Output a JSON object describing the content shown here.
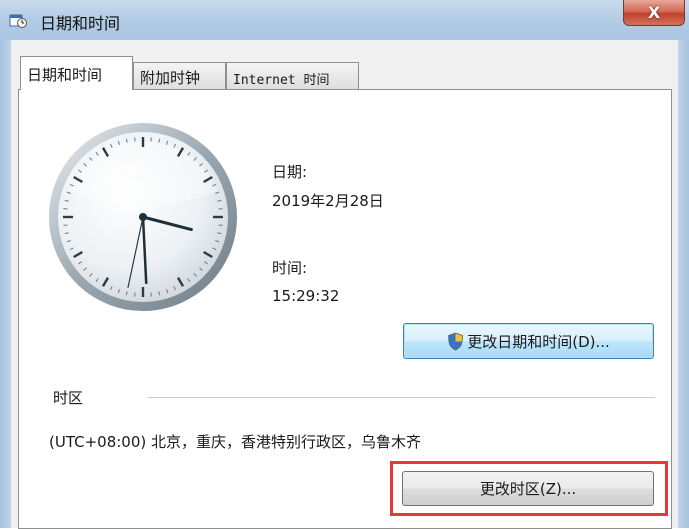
{
  "window": {
    "title": "日期和时间",
    "close_label": "X"
  },
  "tabs": [
    {
      "label": "日期和时间",
      "active": true
    },
    {
      "label": "附加时钟",
      "active": false
    },
    {
      "label": "Internet 时间",
      "active": false
    }
  ],
  "date_section": {
    "date_label": "日期:",
    "date_value": "2019年2月28日",
    "time_label": "时间:",
    "time_value": "15:29:32",
    "change_datetime_button": "更改日期和时间(D)..."
  },
  "timezone_section": {
    "label": "时区",
    "value": "(UTC+08:00) 北京，重庆，香港特别行政区，乌鲁木齐",
    "change_timezone_button": "更改时区(Z)..."
  },
  "clock": {
    "hours": 15,
    "minutes": 29,
    "seconds": 32
  },
  "icons": {
    "app": "date-time-icon",
    "shield": "uac-shield-icon"
  },
  "colors": {
    "highlight": "#e53935",
    "close_button": "#c94a35",
    "title_bar": "#b4cde6"
  }
}
